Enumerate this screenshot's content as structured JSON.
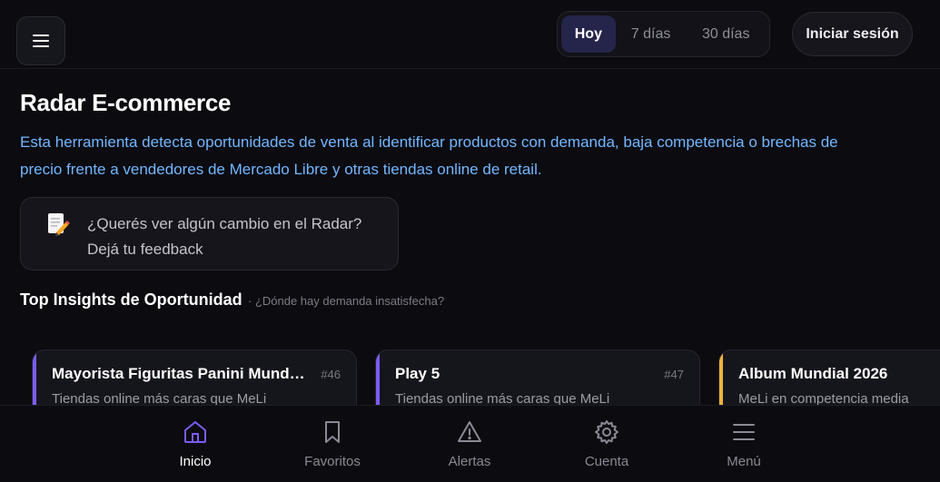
{
  "header": {
    "range_options": [
      {
        "label": "Hoy",
        "active": true
      },
      {
        "label": "7 días",
        "active": false
      },
      {
        "label": "30 días",
        "active": false
      }
    ],
    "login_label": "Iniciar sesión"
  },
  "main": {
    "title": "Radar E-commerce",
    "description_line1": "Esta herramienta detecta oportunidades de venta al identificar productos con demanda, baja competencia o brechas de",
    "description_line2": "precio frente a vendedores de Mercado Libre y otras tiendas online de retail.",
    "feedback": {
      "icon": "memo-pencil-icon",
      "line1": "¿Querés ver algún cambio en el Radar?",
      "line2": "Dejá tu feedback"
    },
    "section_title": "Top Insights de Oportunidad",
    "section_subtitle": "· ¿Dónde hay demanda insatisfecha?"
  },
  "insights": [
    {
      "title": "Mayorista Figuritas Panini Mundial",
      "number": "#46",
      "subtitle": "Tiendas online más caras que MeLi",
      "accent": "#7c5cf5"
    },
    {
      "title": "Play 5",
      "number": "#47",
      "subtitle": "Tiendas online más caras que MeLi",
      "accent": "#7c5cf5"
    },
    {
      "title": "Album Mundial 2026",
      "number": "",
      "subtitle": "MeLi en competencia media",
      "accent": "#f0b23d"
    }
  ],
  "bottom_nav": [
    {
      "label": "Inicio",
      "icon": "home-icon",
      "active": true
    },
    {
      "label": "Favoritos",
      "icon": "bookmark-icon",
      "active": false
    },
    {
      "label": "Alertas",
      "icon": "alert-triangle-icon",
      "active": false
    },
    {
      "label": "Cuenta",
      "icon": "gear-icon",
      "active": false
    },
    {
      "label": "Menú",
      "icon": "menu-icon",
      "active": false
    }
  ],
  "colors": {
    "accent_active": "#7c5cf5",
    "link_blue": "#73b7ff",
    "accent_orange": "#f0b23d"
  }
}
